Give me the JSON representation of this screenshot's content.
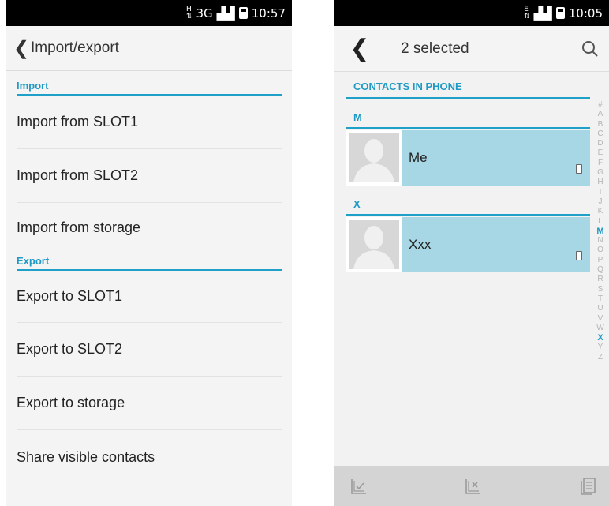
{
  "left": {
    "status": {
      "network": "3G",
      "time": "10:57"
    },
    "header": {
      "title": "Import/export"
    },
    "import": {
      "heading": "Import",
      "items": [
        "Import from SLOT1",
        "Import from SLOT2",
        "Import from storage"
      ]
    },
    "export": {
      "heading": "Export",
      "items": [
        "Export to SLOT1",
        "Export to SLOT2",
        "Export to storage",
        "Share visible contacts"
      ]
    }
  },
  "right": {
    "status": {
      "time": "10:05"
    },
    "header": {
      "title": "2 selected"
    },
    "group": "CONTACTS IN PHONE",
    "sections": [
      {
        "letter": "M",
        "contact": "Me"
      },
      {
        "letter": "X",
        "contact": "Xxx"
      }
    ],
    "index": [
      "#",
      "A",
      "B",
      "C",
      "D",
      "E",
      "F",
      "G",
      "H",
      "I",
      "J",
      "K",
      "L",
      "M",
      "N",
      "O",
      "P",
      "Q",
      "R",
      "S",
      "T",
      "U",
      "V",
      "W",
      "X",
      "Y",
      "Z"
    ],
    "index_active": [
      "M",
      "X"
    ],
    "selected_color": "#a7d6e4",
    "accent": "#1e9ac4"
  }
}
